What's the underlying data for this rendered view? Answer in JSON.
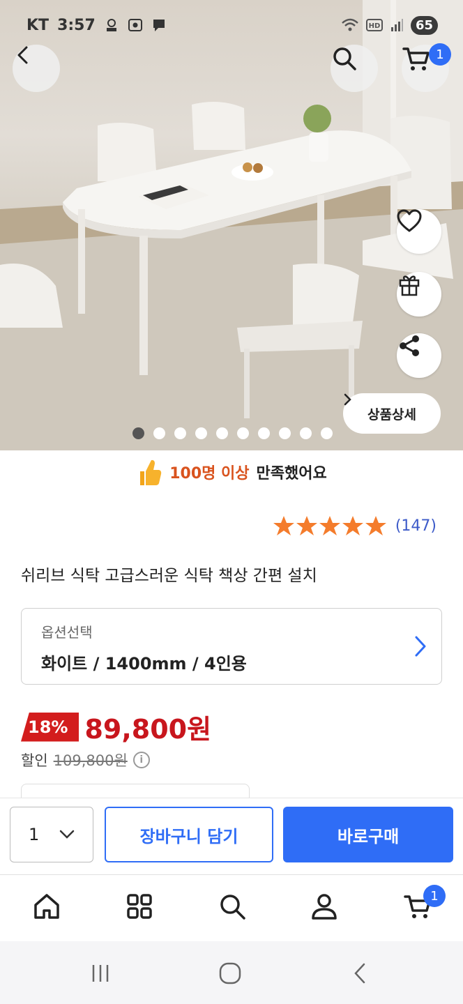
{
  "status_bar": {
    "carrier": "KT",
    "time": "3:57",
    "battery": "65",
    "icons": [
      "samsung-pay-icon",
      "screenshot-icon",
      "message-icon",
      "wifi-icon",
      "hd-icon",
      "signal-icon"
    ]
  },
  "header": {
    "cart_count": "1"
  },
  "hero": {
    "detail_button_label": "상품상세",
    "image_count": 10,
    "active_image": 1
  },
  "satisfaction": {
    "highlight": "100명 이상",
    "text": "만족했어요"
  },
  "rating": {
    "stars": 5,
    "count": "(147)",
    "star_color": "#f47c2c"
  },
  "product": {
    "title": "쉬리브 식탁 고급스러운 식탁 책상 간편 설치"
  },
  "option": {
    "label": "옵션선택",
    "value": "화이트 / 1400mm / 4인용"
  },
  "price": {
    "discount": "18%",
    "sale_price": "89,800원",
    "discount_label": "할인",
    "original_price": "109,800원"
  },
  "purchase_bar": {
    "quantity": "1",
    "cart_button": "장바구니 담기",
    "buy_button": "바로구매"
  },
  "bottom_nav": {
    "items": [
      "home-icon",
      "category-icon",
      "search-icon",
      "profile-icon",
      "cart-icon"
    ],
    "cart_count": "1"
  },
  "colors": {
    "accent": "#2f6df6",
    "sale": "#c8161d",
    "discount_badge": "#d31d1d",
    "highlight": "#d9531e"
  }
}
